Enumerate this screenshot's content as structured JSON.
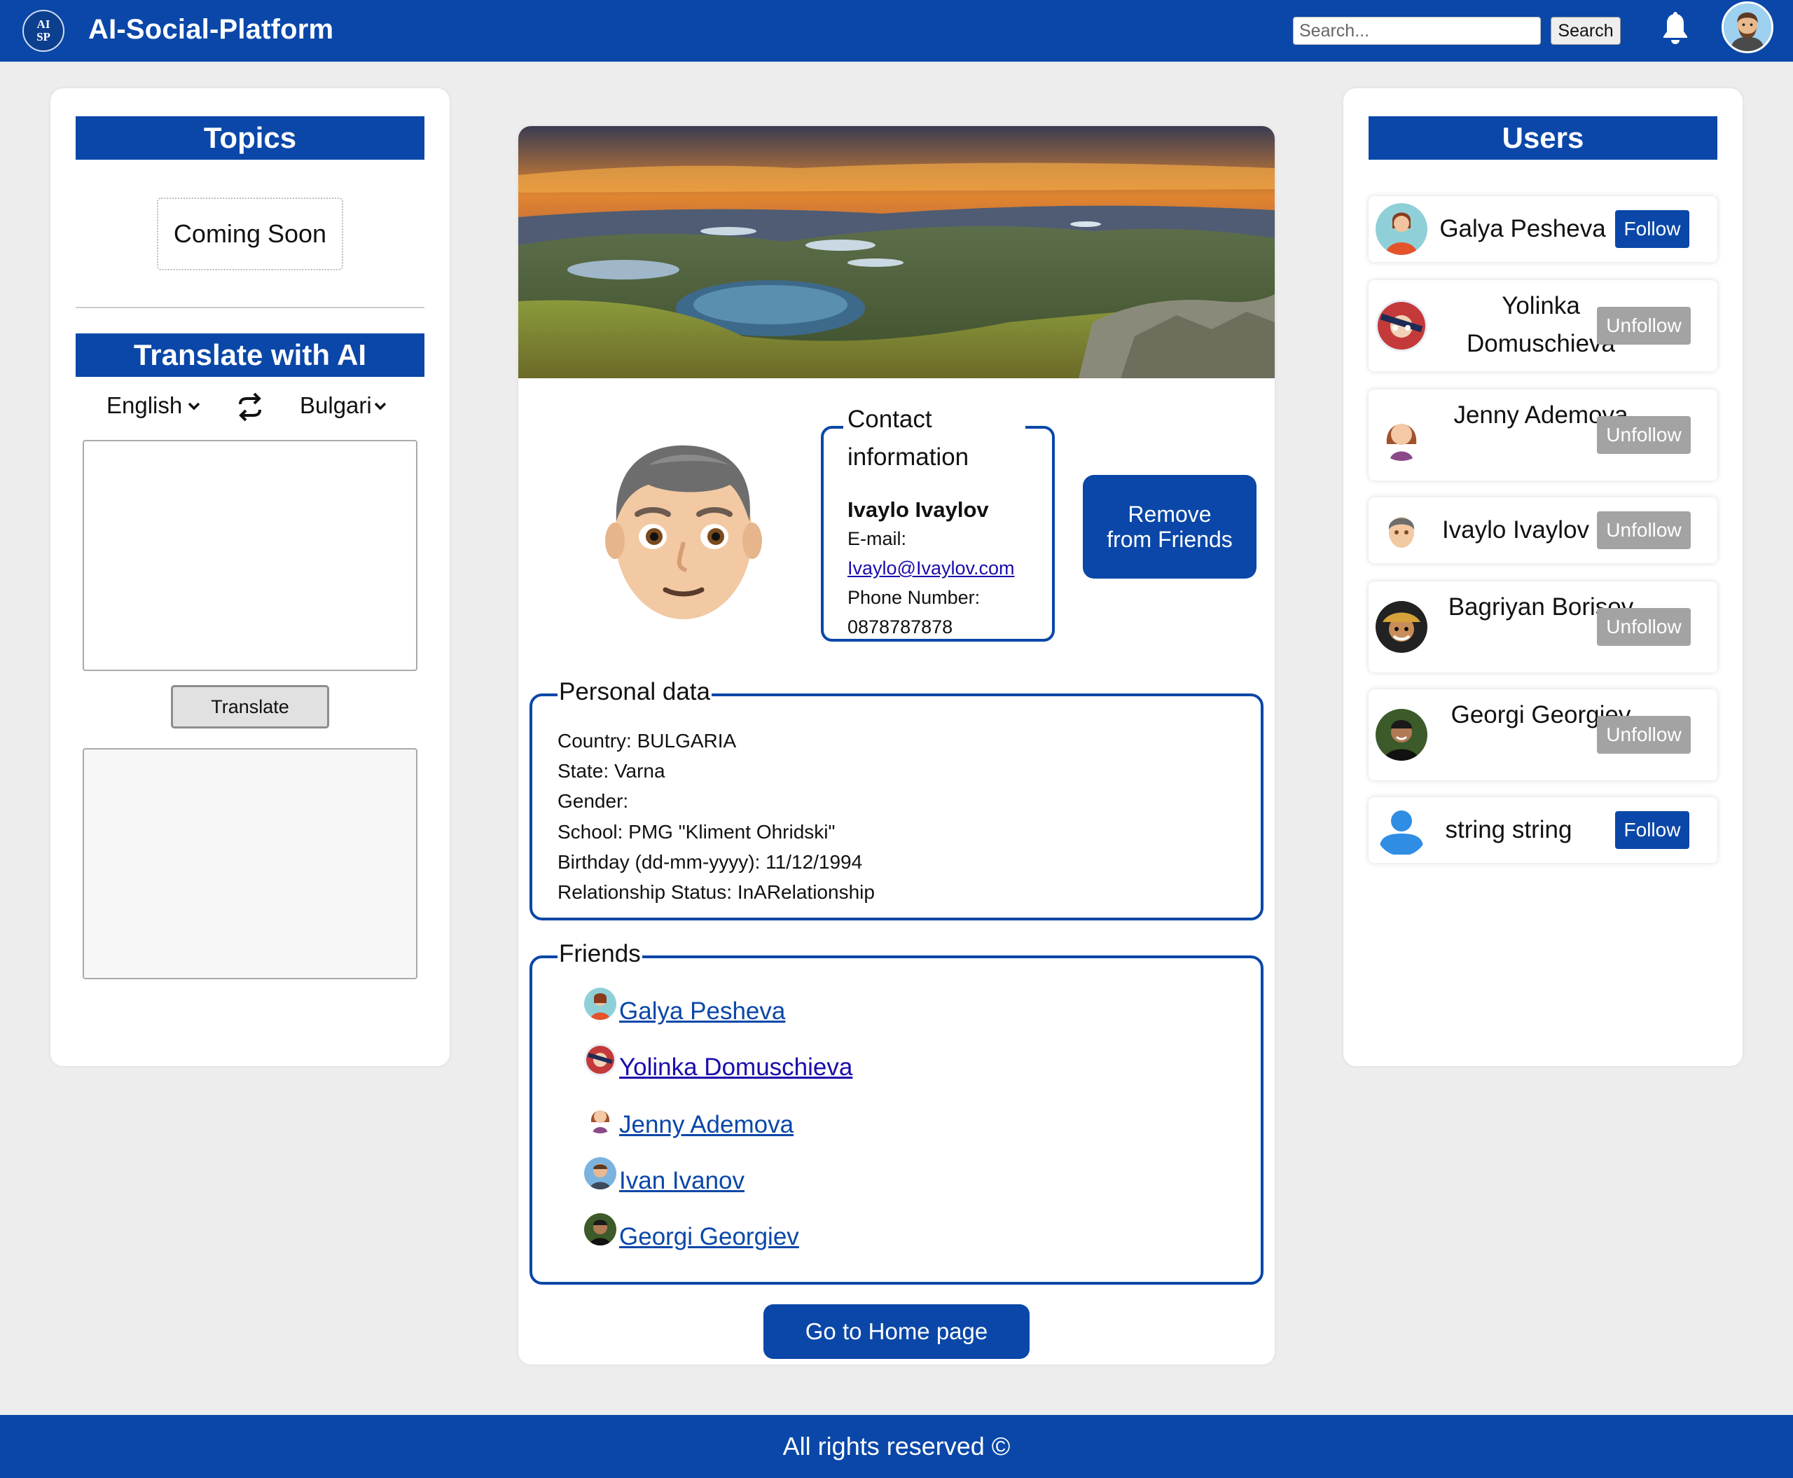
{
  "header": {
    "logo_text_top": "AI",
    "logo_text_bottom": "SP",
    "title": "AI-Social-Platform",
    "search_placeholder": "Search...",
    "search_button": "Search"
  },
  "left": {
    "topics_heading": "Topics",
    "coming_soon": "Coming Soon",
    "translate_heading": "Translate with AI",
    "lang_from": "English",
    "lang_to": "Bulgarian",
    "translate_button": "Translate"
  },
  "profile": {
    "contact_legend": "Contact information",
    "name": "Ivaylo Ivaylov",
    "email_label": "E-mail:",
    "email": "Ivaylo@Ivaylov.com",
    "phone_label": "Phone Number:",
    "phone": "0878787878",
    "remove_button": "Remove from Friends",
    "personal_legend": "Personal data",
    "personal": [
      "Country: BULGARIA",
      "State: Varna",
      "Gender:",
      "School: PMG \"Kliment Ohridski\"",
      "Birthday (dd-mm-yyyy): 11/12/1994",
      "Relationship Status: InARelationship"
    ],
    "friends_legend": "Friends",
    "friends": [
      "Galya Pesheva",
      "Yolinka Domuschieva",
      "Jenny Ademova",
      "Ivan Ivanov",
      "Georgi Georgiev"
    ],
    "home_button": "Go to Home page"
  },
  "users": {
    "heading": "Users",
    "items": [
      {
        "name": "Galya Pesheva",
        "action": "Follow"
      },
      {
        "name": "Yolinka Domuschieva",
        "action": "Unfollow"
      },
      {
        "name": "Jenny Ademova",
        "action": "Unfollow"
      },
      {
        "name": "Ivaylo Ivaylov",
        "action": "Unfollow"
      },
      {
        "name": "Bagriyan Borisov",
        "action": "Unfollow"
      },
      {
        "name": "Georgi Georgiev",
        "action": "Unfollow"
      },
      {
        "name": "string string",
        "action": "Follow"
      }
    ]
  },
  "footer": {
    "text": "All rights reserved ©"
  },
  "colors": {
    "brand": "#0a47a8",
    "unfollow": "#a3a3a3",
    "background": "#ededed"
  },
  "icons": [
    "logo-icon",
    "bell-icon",
    "swap-icon",
    "chevron-down-icon",
    "avatar-icon"
  ]
}
